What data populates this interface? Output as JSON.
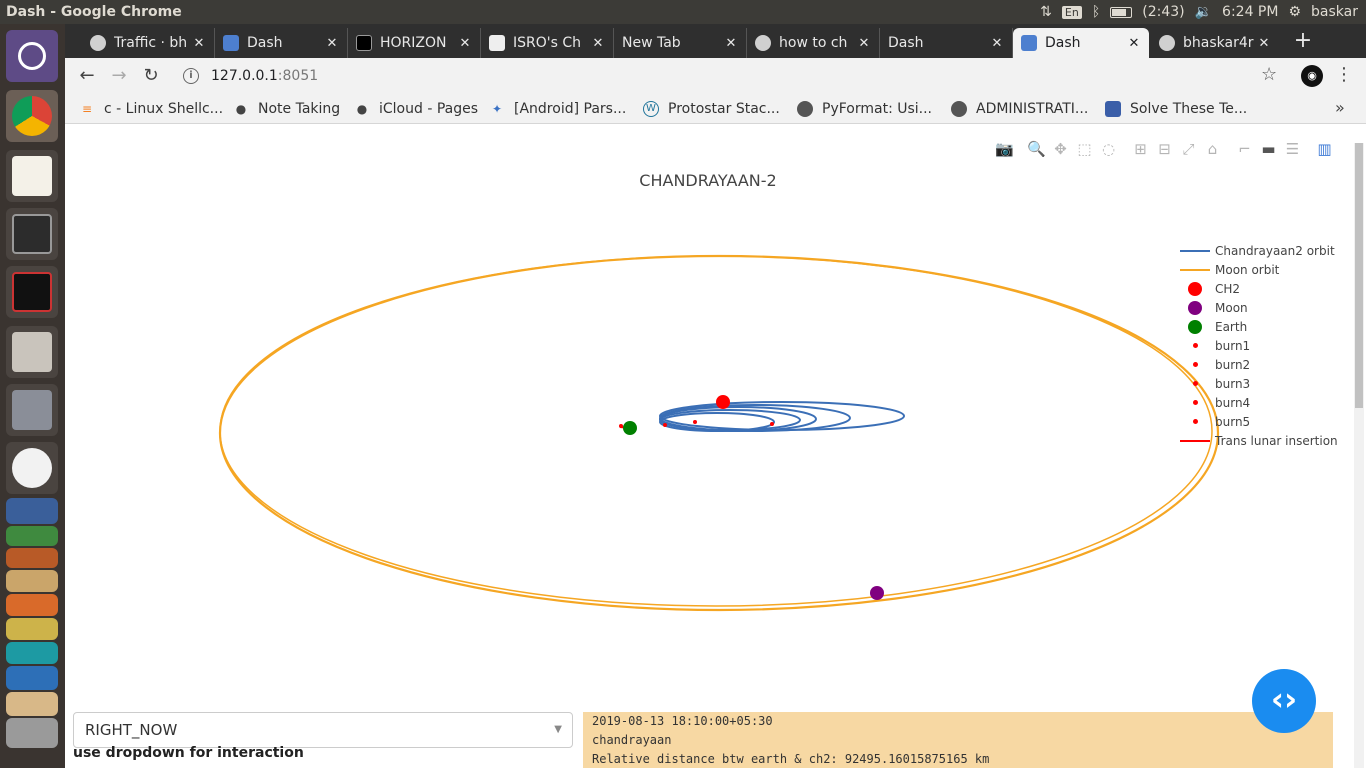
{
  "window": {
    "title": "Dash - Google Chrome"
  },
  "system_tray": {
    "keyboard": "En",
    "battery": "(2:43)",
    "time": "6:24 PM",
    "user": "baskar"
  },
  "launcher": {
    "apps": [
      "ubuntu-dash",
      "chrome",
      "text-editor",
      "terminal",
      "xterm",
      "files",
      "installer",
      "evince",
      "writer",
      "calc",
      "impress",
      "amazon",
      "software-center",
      "arduino",
      "launcher-app",
      "bread-app",
      "scanner"
    ]
  },
  "tabs": [
    {
      "label": "Traffic · bh",
      "icon": "github-icon",
      "active": false
    },
    {
      "label": "Dash",
      "icon": "dash-icon",
      "active": false
    },
    {
      "label": "HORIZON",
      "icon": "horizons-icon",
      "active": false
    },
    {
      "label": "ISRO's Ch",
      "icon": "qt-icon",
      "active": false
    },
    {
      "label": "New Tab",
      "icon": "",
      "active": false
    },
    {
      "label": "how to ch",
      "icon": "github-icon",
      "active": false
    },
    {
      "label": "Dash",
      "icon": "dash-icon",
      "active": false
    },
    {
      "label": "Dash",
      "icon": "dash-icon",
      "active": true
    },
    {
      "label": "bhaskar4r",
      "icon": "github-icon",
      "active": false
    }
  ],
  "toolbar": {
    "url_host": "127.0.0.1",
    "url_port": ":8051"
  },
  "bookmarks": [
    {
      "label": "c - Linux Shellc...",
      "icon": "stackoverflow-icon"
    },
    {
      "label": "Note Taking",
      "icon": "apple-icon"
    },
    {
      "label": "iCloud - Pages",
      "icon": "apple-icon"
    },
    {
      "label": "[Android] Pars...",
      "icon": "puzzle-icon"
    },
    {
      "label": "Protostar Stac...",
      "icon": "wordpress-icon"
    },
    {
      "label": "PyFormat: Usi...",
      "icon": "globe-icon"
    },
    {
      "label": "ADMINISTRATI...",
      "icon": "globe-icon"
    },
    {
      "label": "Solve These Te...",
      "icon": "doc-icon"
    }
  ],
  "chart_data": {
    "type": "scatter",
    "title": "CHANDRAYAAN-2",
    "xlabel": "",
    "ylabel": "",
    "grid": false,
    "legend_position": "right",
    "series": [
      {
        "name": "Chandrayaan2 orbit",
        "kind": "line",
        "color": "#3b6fb6"
      },
      {
        "name": "Moon orbit",
        "kind": "line",
        "color": "#f5a623"
      },
      {
        "name": "CH2",
        "kind": "marker",
        "color": "#ff0000",
        "size": "large"
      },
      {
        "name": "Moon",
        "kind": "marker",
        "color": "#800080",
        "size": "large"
      },
      {
        "name": "Earth",
        "kind": "marker",
        "color": "#008000",
        "size": "large"
      },
      {
        "name": "burn1",
        "kind": "marker",
        "color": "#ff0000",
        "size": "small"
      },
      {
        "name": "burn2",
        "kind": "marker",
        "color": "#ff0000",
        "size": "small"
      },
      {
        "name": "burn3",
        "kind": "marker",
        "color": "#ff0000",
        "size": "small"
      },
      {
        "name": "burn4",
        "kind": "marker",
        "color": "#ff0000",
        "size": "small"
      },
      {
        "name": "burn5",
        "kind": "marker",
        "color": "#ff0000",
        "size": "small"
      },
      {
        "name": "Trans lunar insertion",
        "kind": "line",
        "color": "#ff0000"
      }
    ]
  },
  "controls": {
    "dropdown_value": "RIGHT_NOW",
    "hint": "use dropdown for interaction"
  },
  "info_panel": {
    "timestamp": "2019-08-13 18:10:00+05:30",
    "object": "chandrayaan",
    "distance": "Relative distance btw earth & ch2: 92495.16015875165 km"
  }
}
